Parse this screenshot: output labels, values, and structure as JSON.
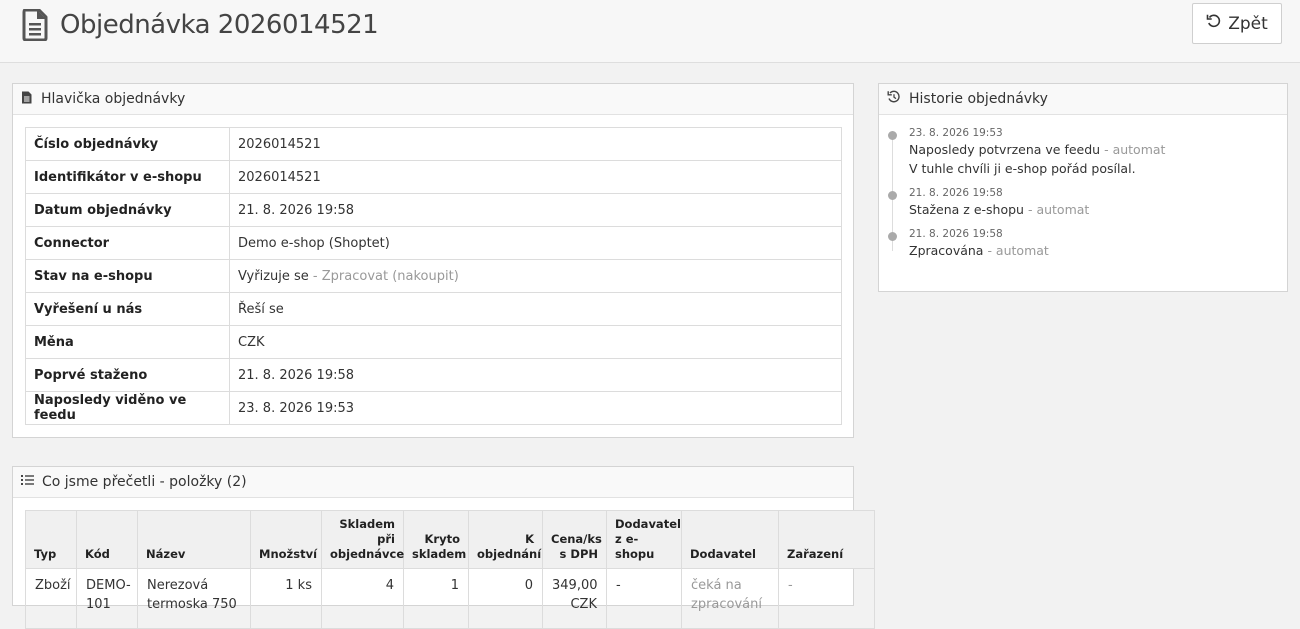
{
  "header": {
    "title": "Objednávka 2026014521",
    "back_label": "Zpět"
  },
  "order_header": {
    "title": "Hlavička objednávky",
    "rows": [
      {
        "key": "Číslo objednávky",
        "value": "2026014521",
        "extra": ""
      },
      {
        "key": "Identifikátor v e-shopu",
        "value": "2026014521",
        "extra": ""
      },
      {
        "key": "Datum objednávky",
        "value": "21. 8. 2026 19:58",
        "extra": ""
      },
      {
        "key": "Connector",
        "value": "Demo e-shop (Shoptet)",
        "extra": ""
      },
      {
        "key": "Stav na e-shopu",
        "value": "Vyřizuje se",
        "extra": "- Zpracovat (nakoupit)"
      },
      {
        "key": "Vyřešení u nás",
        "value": "Řeší se",
        "extra": ""
      },
      {
        "key": "Měna",
        "value": "CZK",
        "extra": ""
      },
      {
        "key": "Poprvé staženo",
        "value": "21. 8. 2026 19:58",
        "extra": ""
      },
      {
        "key": "Naposledy viděno ve feedu",
        "value": "23. 8. 2026 19:53",
        "extra": ""
      }
    ]
  },
  "history": {
    "title": "Historie objednávky",
    "entries": [
      {
        "date": "23. 8. 2026 19:53",
        "text": "Naposledy potvrzena ve feedu",
        "by": "- automat",
        "note": "V tuhle chvíli ji e-shop pořád posílal."
      },
      {
        "date": "21. 8. 2026 19:58",
        "text": "Stažena z e-shopu",
        "by": "- automat",
        "note": ""
      },
      {
        "date": "21. 8. 2026 19:58",
        "text": "Zpracována",
        "by": "- automat",
        "note": ""
      }
    ]
  },
  "items": {
    "title": "Co jsme přečetli - položky (2)",
    "columns": {
      "type": "Typ",
      "code": "Kód",
      "name": "Název",
      "qty": "Množství",
      "stock_at_order": "Skladem při objednávce",
      "covered": "Kryto skladem",
      "to_order": "K objednání",
      "price": "Cena/ks s DPH",
      "supplier_eshop": "Dodavatel z e-shopu",
      "supplier": "Dodavatel",
      "category": "Zařazení"
    },
    "rows": [
      {
        "type": "Zboží",
        "code": "DEMO-101",
        "name": "Nerezová termoska 750",
        "qty": "1 ks",
        "stock_at_order": "4",
        "covered": "1",
        "to_order": "0",
        "price": "349,00 CZK",
        "supplier_eshop": "-",
        "supplier": "čeká na zpracování",
        "category": "-"
      }
    ]
  }
}
